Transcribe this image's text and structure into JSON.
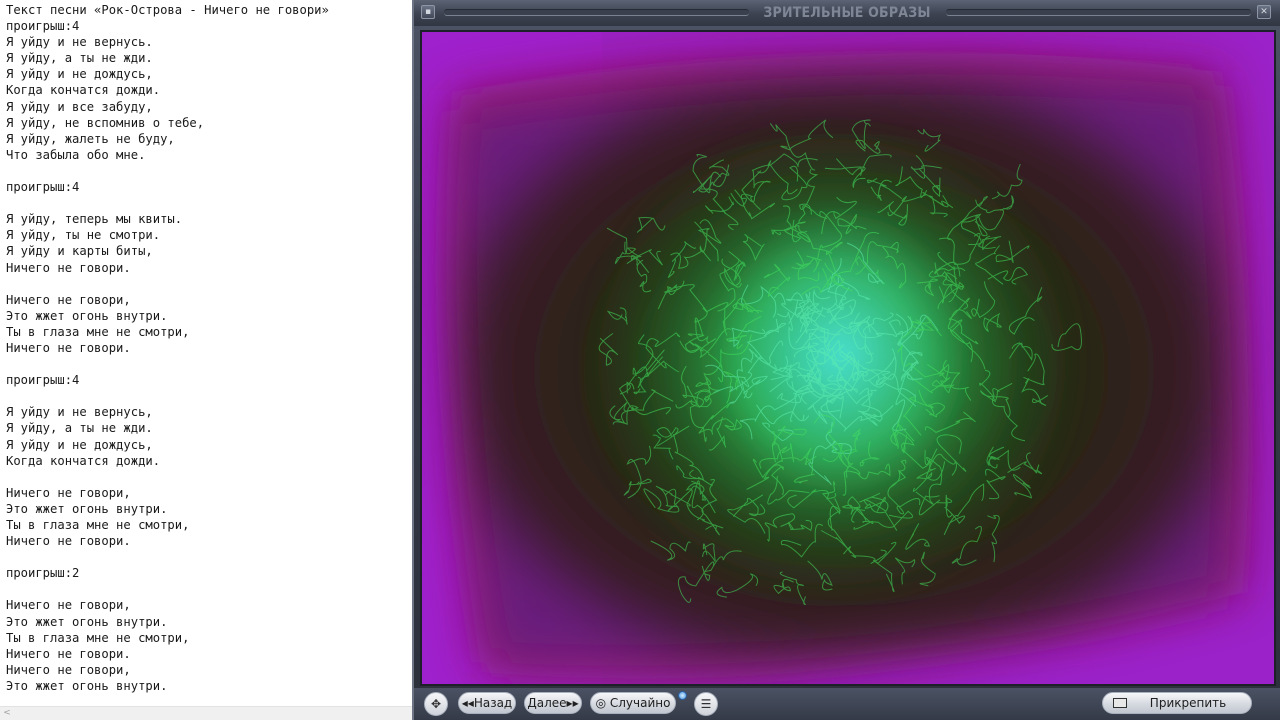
{
  "editor": {
    "lines": [
      "Текст песни «Рок-Острова - Ничего не говори»",
      "проигрыш:4",
      "Я уйду и не вернусь.",
      "Я уйду, а ты не жди.",
      "Я уйду и не дождусь,",
      "Когда кончатся дожди.",
      "Я уйду и все забуду,",
      "Я уйду, не вспомнив о тебе,",
      "Я уйду, жалеть не буду,",
      "Что забыла обо мне.",
      "",
      "проигрыш:4",
      "",
      "Я уйду, теперь мы квиты.",
      "Я уйду, ты не смотри.",
      "Я уйду и карты биты,",
      "Ничего не говори.",
      "",
      "Ничего не говори,",
      "Это жжет огонь внутри.",
      "Ты в глаза мне не смотри,",
      "Ничего не говори.",
      "",
      "проигрыш:4",
      "",
      "Я уйду и не вернусь,",
      "Я уйду, а ты не жди.",
      "Я уйду и не дождусь,",
      "Когда кончатся дожди.",
      "",
      "Ничего не говори,",
      "Это жжет огонь внутри.",
      "Ты в глаза мне не смотри,",
      "Ничего не говори.",
      "",
      "проигрыш:2",
      "",
      "Ничего не говори,",
      "Это жжет огонь внутри.",
      "Ты в глаза мне не смотри,",
      "Ничего не говори.",
      "Ничего не говори,",
      "Это жжет огонь внутри."
    ],
    "scroll_left_glyph": "<"
  },
  "visualizer": {
    "title": "ЗРИТЕЛЬНЫЕ ОБРАЗЫ",
    "minimize_glyph": "▪",
    "close_glyph": "✕",
    "controls": {
      "move_glyph": "✥",
      "back_label": "◂◂Назад",
      "next_label": "Далее▸▸",
      "random_label": "◎ Случайно",
      "menu_glyph": "☰",
      "attach_label": "Прикрепить"
    },
    "colors": {
      "background": "#9a1ec2",
      "glow": "#2ef07a",
      "core": "#3ad6c8",
      "dark": "#2b1a16"
    }
  }
}
